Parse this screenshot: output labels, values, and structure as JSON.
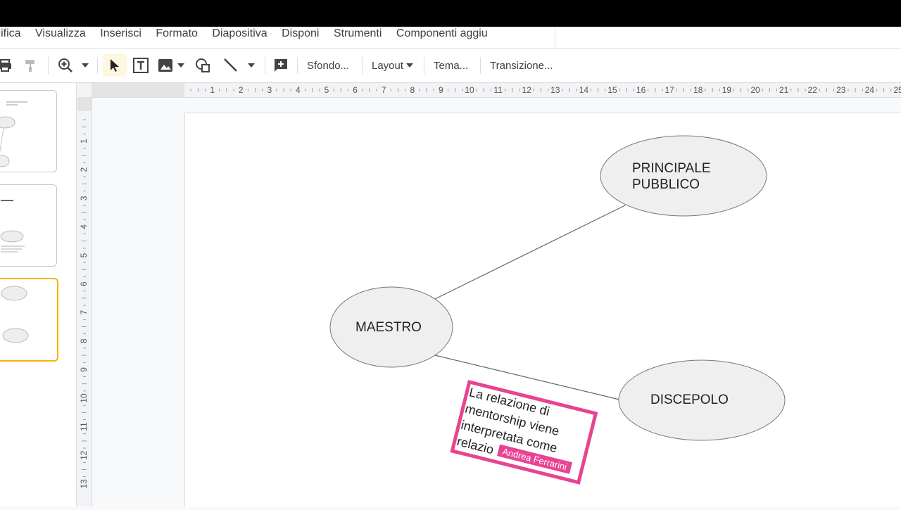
{
  "menu": {
    "items": [
      "Modifica",
      "Visualizza",
      "Inserisci",
      "Formato",
      "Diapositiva",
      "Disponi",
      "Strumenti",
      "Componenti aggiu"
    ]
  },
  "toolbar": {
    "background_label": "Sfondo...",
    "layout_label": "Layout",
    "theme_label": "Tema...",
    "transition_label": "Transizione..."
  },
  "ruler": {
    "horizontal_ticks": [
      "1",
      "2",
      "3",
      "4",
      "5",
      "6",
      "7",
      "8",
      "9",
      "10",
      "11",
      "12",
      "13",
      "14",
      "15",
      "16",
      "17",
      "18",
      "19",
      "20",
      "21",
      "22",
      "23",
      "24",
      "25"
    ],
    "vertical_ticks": [
      "1",
      "2",
      "3",
      "4",
      "5",
      "6",
      "7",
      "8",
      "9",
      "10",
      "11",
      "12",
      "13"
    ]
  },
  "slide": {
    "nodes": {
      "principale": [
        "PRINCIPALE",
        "PUBBLICO"
      ],
      "maestro": "MAESTRO",
      "discepolo": "DISCEPOLO"
    },
    "note_text": [
      "La relazione di",
      "mentorship viene",
      "interpretata come",
      "relazio"
    ],
    "collaborator_tag": "Andrea Ferrarini"
  },
  "colors": {
    "collaborator": "#e84393",
    "selected_thumbnail": "#f4b400",
    "ellipse_fill": "#efefef"
  }
}
